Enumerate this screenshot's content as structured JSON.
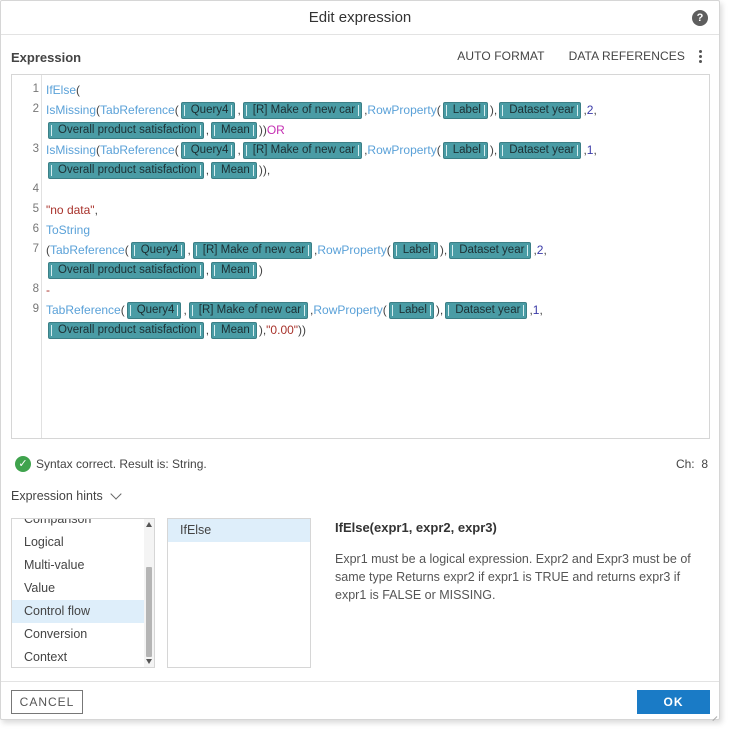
{
  "dialog": {
    "title": "Edit expression",
    "help_icon": "question-circle-icon",
    "section_label": "Expression",
    "actions": {
      "auto_format": "AUTO FORMAT",
      "data_references": "DATA REFERENCES",
      "more_icon": "kebab-icon"
    }
  },
  "editor": {
    "line_numbers": [
      "1",
      "2",
      "3",
      "4",
      "5",
      "6",
      "7",
      "8",
      "9"
    ],
    "lines": [
      {
        "n": "1",
        "segs": [
          {
            "t": "fn",
            "v": "IfElse"
          },
          {
            "t": "pl",
            "v": "("
          }
        ]
      },
      {
        "n": "2",
        "segs": [
          {
            "t": "fn",
            "v": "IsMissing"
          },
          {
            "t": "pl",
            "v": "("
          },
          {
            "t": "fn",
            "v": "TabReference"
          },
          {
            "t": "pl",
            "v": "( "
          },
          {
            "t": "tok",
            "v": "Query4"
          },
          {
            "t": "pl",
            "v": " , "
          },
          {
            "t": "tok",
            "v": "[R] Make of new car"
          },
          {
            "t": "pl",
            "v": " ,"
          },
          {
            "t": "fn",
            "v": "RowProperty"
          },
          {
            "t": "pl",
            "v": "( "
          },
          {
            "t": "tok",
            "v": "Label"
          },
          {
            "t": "pl",
            "v": " ), "
          },
          {
            "t": "tok",
            "v": "Dataset year"
          },
          {
            "t": "pl",
            "v": " ,"
          },
          {
            "t": "num",
            "v": "2"
          },
          {
            "t": "pl",
            "v": ","
          }
        ]
      },
      {
        "n": "",
        "segs": [
          {
            "t": "tok",
            "v": "Overall product satisfaction"
          },
          {
            "t": "pl",
            "v": " , "
          },
          {
            "t": "tok",
            "v": "Mean"
          },
          {
            "t": "pl",
            "v": " )) "
          },
          {
            "t": "kw",
            "v": "OR"
          }
        ]
      },
      {
        "n": "3",
        "segs": [
          {
            "t": "fn",
            "v": "IsMissing"
          },
          {
            "t": "pl",
            "v": "("
          },
          {
            "t": "fn",
            "v": "TabReference"
          },
          {
            "t": "pl",
            "v": "( "
          },
          {
            "t": "tok",
            "v": "Query4"
          },
          {
            "t": "pl",
            "v": " , "
          },
          {
            "t": "tok",
            "v": "[R] Make of new car"
          },
          {
            "t": "pl",
            "v": " ,"
          },
          {
            "t": "fn",
            "v": "RowProperty"
          },
          {
            "t": "pl",
            "v": "( "
          },
          {
            "t": "tok",
            "v": "Label"
          },
          {
            "t": "pl",
            "v": " ), "
          },
          {
            "t": "tok",
            "v": "Dataset year"
          },
          {
            "t": "pl",
            "v": " ,"
          },
          {
            "t": "num",
            "v": "1"
          },
          {
            "t": "pl",
            "v": ","
          }
        ]
      },
      {
        "n": "",
        "segs": [
          {
            "t": "tok",
            "v": "Overall product satisfaction"
          },
          {
            "t": "pl",
            "v": " , "
          },
          {
            "t": "tok",
            "v": "Mean"
          },
          {
            "t": "pl",
            "v": " )),"
          }
        ]
      },
      {
        "n": "4",
        "segs": []
      },
      {
        "n": "5",
        "segs": [
          {
            "t": "str",
            "v": "\"no data\""
          },
          {
            "t": "pl",
            "v": ","
          }
        ]
      },
      {
        "n": "6",
        "segs": [
          {
            "t": "fn",
            "v": "ToString"
          }
        ]
      },
      {
        "n": "7",
        "segs": [
          {
            "t": "pl",
            "v": "("
          },
          {
            "t": "fn",
            "v": "TabReference"
          },
          {
            "t": "pl",
            "v": "( "
          },
          {
            "t": "tok",
            "v": "Query4"
          },
          {
            "t": "pl",
            "v": " , "
          },
          {
            "t": "tok",
            "v": "[R] Make of new car"
          },
          {
            "t": "pl",
            "v": " ,"
          },
          {
            "t": "fn",
            "v": "RowProperty"
          },
          {
            "t": "pl",
            "v": "( "
          },
          {
            "t": "tok",
            "v": "Label"
          },
          {
            "t": "pl",
            "v": " ), "
          },
          {
            "t": "tok",
            "v": "Dataset year"
          },
          {
            "t": "pl",
            "v": " ,"
          },
          {
            "t": "num",
            "v": "2"
          },
          {
            "t": "pl",
            "v": ","
          }
        ]
      },
      {
        "n": "",
        "segs": [
          {
            "t": "tok",
            "v": "Overall product satisfaction"
          },
          {
            "t": "pl",
            "v": " , "
          },
          {
            "t": "tok",
            "v": "Mean"
          },
          {
            "t": "pl",
            "v": " )"
          }
        ]
      },
      {
        "n": "8",
        "segs": [
          {
            "t": "str",
            "v": "-"
          }
        ]
      },
      {
        "n": "9",
        "segs": [
          {
            "t": "fn",
            "v": "TabReference"
          },
          {
            "t": "pl",
            "v": "( "
          },
          {
            "t": "tok",
            "v": "Query4"
          },
          {
            "t": "pl",
            "v": " , "
          },
          {
            "t": "tok",
            "v": "[R] Make of new car"
          },
          {
            "t": "pl",
            "v": " ,"
          },
          {
            "t": "fn",
            "v": "RowProperty"
          },
          {
            "t": "pl",
            "v": "( "
          },
          {
            "t": "tok",
            "v": "Label"
          },
          {
            "t": "pl",
            "v": " ), "
          },
          {
            "t": "tok",
            "v": "Dataset year"
          },
          {
            "t": "pl",
            "v": " ,"
          },
          {
            "t": "num",
            "v": "1"
          },
          {
            "t": "pl",
            "v": ","
          }
        ]
      },
      {
        "n": "",
        "segs": [
          {
            "t": "tok",
            "v": "Overall product satisfaction"
          },
          {
            "t": "pl",
            "v": " , "
          },
          {
            "t": "tok",
            "v": "Mean"
          },
          {
            "t": "pl",
            "v": " ),"
          },
          {
            "t": "str",
            "v": "\"0.00\""
          },
          {
            "t": "pl",
            "v": "))"
          }
        ]
      }
    ]
  },
  "status": {
    "icon": "check-circle-icon",
    "text": "Syntax correct. Result is: String.",
    "ch_label": "Ch:",
    "ch_value": "8"
  },
  "hints": {
    "header": "Expression hints",
    "header_icon": "chevron-down-icon",
    "categories": [
      "Comparison",
      "Logical",
      "Multi-value",
      "Value",
      "Control flow",
      "Conversion",
      "Context"
    ],
    "selected_category": "Control flow",
    "functions": [
      "IfElse"
    ],
    "selected_function": "IfElse",
    "signature": "IfElse(expr1, expr2, expr3)",
    "description": "Expr1 must be a logical expression. Expr2 and Expr3 must be of same type Returns expr2 if expr1 is TRUE and returns expr3 if expr1 is FALSE or MISSING."
  },
  "footer": {
    "cancel_label": "CANCEL",
    "ok_label": "OK"
  },
  "colors": {
    "token_bg": "#4a9ca5",
    "function": "#5aa1d8",
    "keyword": "#c530b3",
    "string": "#a8322b",
    "ok_button": "#1a7bc6",
    "selection": "#deeefa",
    "success": "#3fa34d"
  }
}
